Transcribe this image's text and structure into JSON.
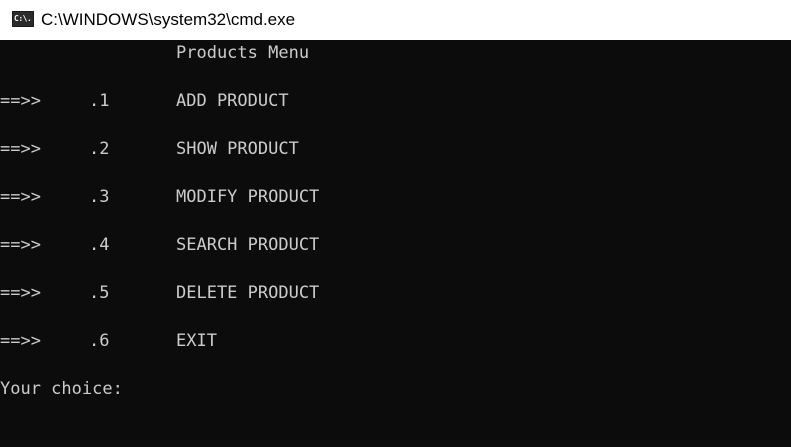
{
  "window": {
    "title": "C:\\WINDOWS\\system32\\cmd.exe",
    "icon_text": "C:\\.",
    "icon": "console-app-icon"
  },
  "console": {
    "heading": "Products Menu",
    "menu": [
      {
        "arrow": "==>>",
        "number": ".1",
        "label": "ADD PRODUCT"
      },
      {
        "arrow": "==>>",
        "number": ".2",
        "label": "SHOW PRODUCT"
      },
      {
        "arrow": "==>>",
        "number": ".3",
        "label": "MODIFY PRODUCT"
      },
      {
        "arrow": "==>>",
        "number": ".4",
        "label": "SEARCH PRODUCT"
      },
      {
        "arrow": "==>>",
        "number": ".5",
        "label": "DELETE PRODUCT"
      },
      {
        "arrow": "==>>",
        "number": ".6",
        "label": "EXIT"
      }
    ],
    "prompt": "Your choice:"
  },
  "colors": {
    "console_bg": "#0c0c0c",
    "console_text": "#cccccc",
    "titlebar_bg": "#ffffff"
  }
}
